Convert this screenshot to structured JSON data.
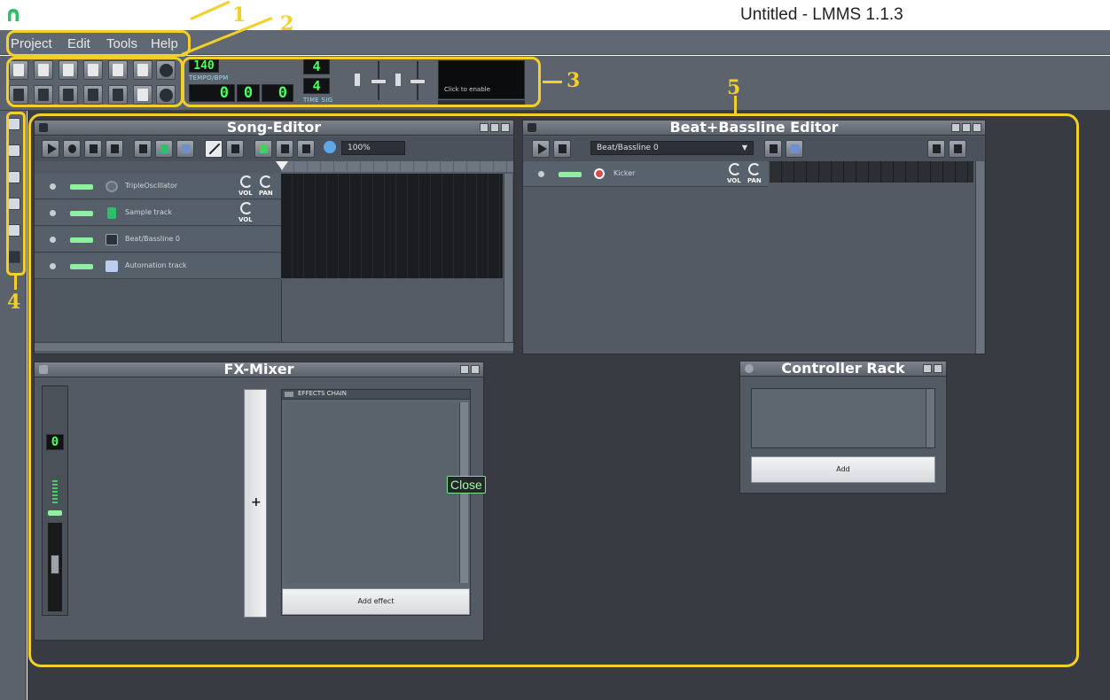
{
  "window": {
    "title": "Untitled - LMMS 1.1.3",
    "icon": "lmms-logo-icon"
  },
  "menu": {
    "items": [
      "Project",
      "Edit",
      "Tools",
      "Help"
    ]
  },
  "toolbar": {
    "tempo_value": "140",
    "tempo_label": "TEMPO/BPM",
    "time_min": "0",
    "time_sec": "0",
    "time_msec": "0",
    "timesig_num": "4",
    "timesig_den": "4",
    "timesig_label": "TIME SIG",
    "scope_text": "Click to enable"
  },
  "song_editor": {
    "title": "Song-Editor",
    "zoom": "100%",
    "tracks": [
      {
        "name": "TripleOscillator",
        "icon": "oscillator-icon",
        "has_pan": true
      },
      {
        "name": "Sample track",
        "icon": "sample-icon",
        "has_pan": false
      },
      {
        "name": "Beat/Bassline 0",
        "icon": "beat-icon",
        "has_pan": false
      },
      {
        "name": "Automation track",
        "icon": "automation-icon",
        "has_pan": false
      }
    ],
    "vol_label": "VOL",
    "pan_label": "PAN"
  },
  "bb_editor": {
    "title": "Beat+Bassline Editor",
    "selector": "Beat/Bassline 0",
    "track_name": "Kicker",
    "vol_label": "VOL",
    "pan_label": "PAN"
  },
  "fx_mixer": {
    "title": "FX-Mixer",
    "channel_value": "0",
    "effects_chain_label": "EFFECTS CHAIN",
    "add_effect": "Add effect",
    "tooltip": "Close"
  },
  "controller_rack": {
    "title": "Controller Rack",
    "add": "Add"
  },
  "annotations": [
    "1",
    "2",
    "3",
    "4",
    "5"
  ],
  "colors": {
    "annotation": "#f4cf2a",
    "lcd": "#48ff5c"
  }
}
